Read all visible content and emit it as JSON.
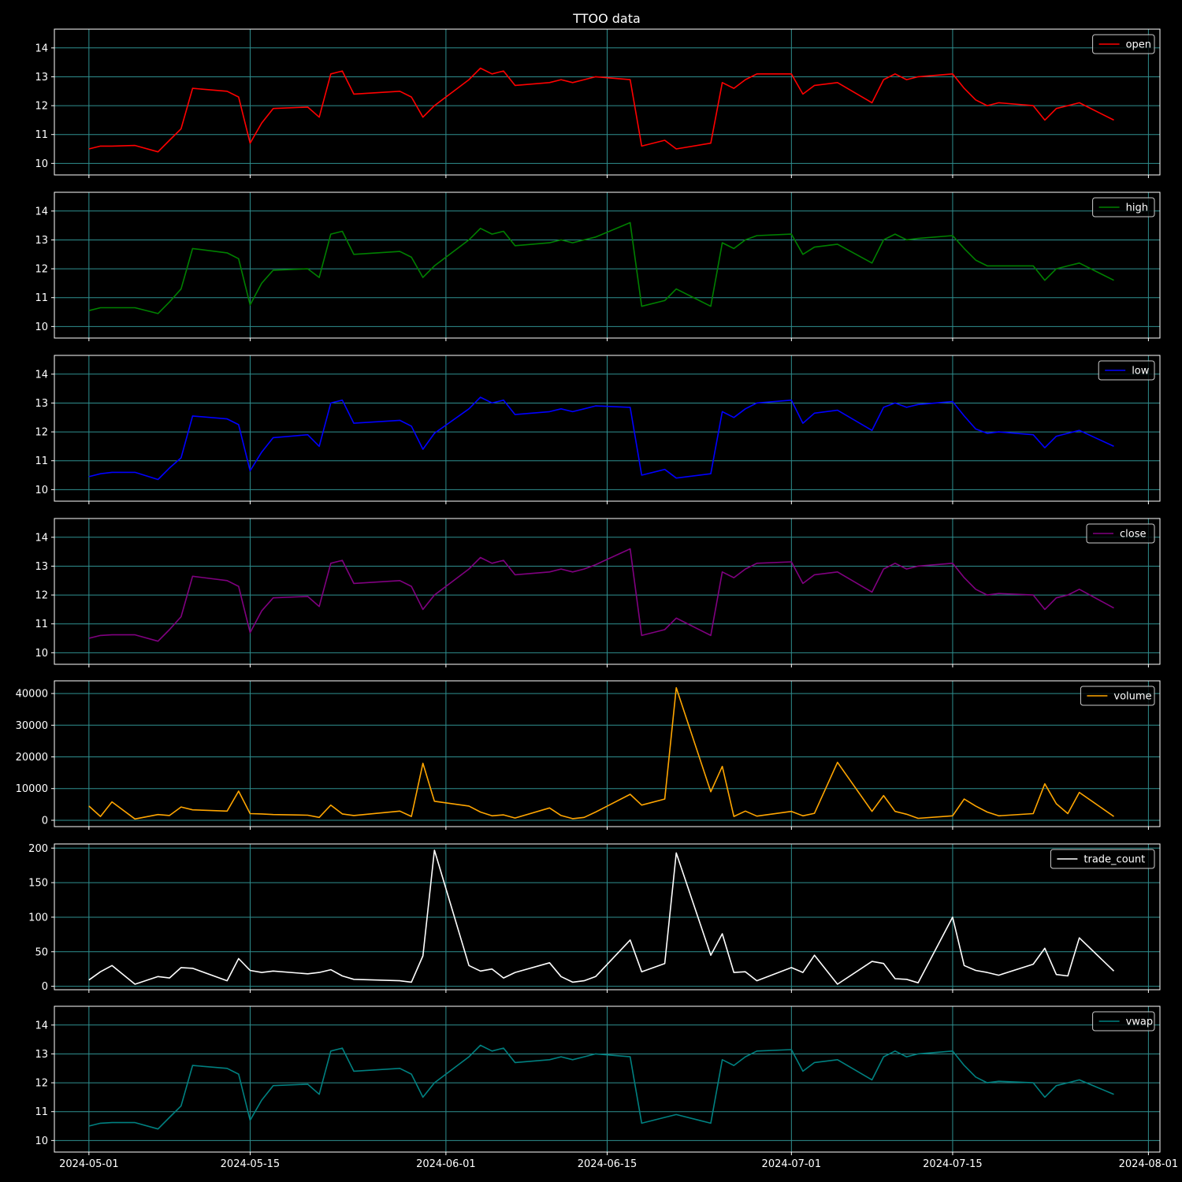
{
  "chart_data": {
    "type": "line",
    "title": "TTOO data",
    "background": "#000000",
    "grid_color": "#2f8f8f",
    "grid": true,
    "legend_position": "top-right",
    "x_axis": {
      "type": "date",
      "range": [
        "2024-04-28",
        "2024-08-02"
      ],
      "ticks": [
        "2024-05-01",
        "2024-05-15",
        "2024-06-01",
        "2024-06-15",
        "2024-07-01",
        "2024-07-15",
        "2024-08-01"
      ]
    },
    "price_axis": {
      "ylim": [
        9.6,
        14.65
      ],
      "ticks": [
        "10",
        "11",
        "12",
        "13",
        "14"
      ]
    },
    "volume_axis": {
      "ylim": [
        -2000,
        44000
      ],
      "ticks": [
        "0",
        "10000",
        "20000",
        "30000",
        "40000"
      ]
    },
    "trade_count_axis": {
      "ylim": [
        -5,
        206
      ],
      "ticks": [
        "0",
        "50",
        "100",
        "150",
        "200"
      ]
    },
    "series": [
      {
        "name": "open",
        "color": "#ff0000",
        "axis": "price_axis",
        "x": [
          "2024-05-01",
          "2024-05-02",
          "2024-05-03",
          "2024-05-05",
          "2024-05-07",
          "2024-05-08",
          "2024-05-09",
          "2024-05-10",
          "2024-05-13",
          "2024-05-14",
          "2024-05-15",
          "2024-05-16",
          "2024-05-17",
          "2024-05-20",
          "2024-05-21",
          "2024-05-22",
          "2024-05-23",
          "2024-05-24",
          "2024-05-28",
          "2024-05-29",
          "2024-05-30",
          "2024-05-31",
          "2024-06-03",
          "2024-06-04",
          "2024-06-05",
          "2024-06-06",
          "2024-06-07",
          "2024-06-10",
          "2024-06-11",
          "2024-06-12",
          "2024-06-13",
          "2024-06-14",
          "2024-06-17",
          "2024-06-18",
          "2024-06-20",
          "2024-06-21",
          "2024-06-24",
          "2024-06-25",
          "2024-06-26",
          "2024-06-27",
          "2024-06-28",
          "2024-07-01",
          "2024-07-02",
          "2024-07-03",
          "2024-07-05",
          "2024-07-08",
          "2024-07-09",
          "2024-07-10",
          "2024-07-11",
          "2024-07-12",
          "2024-07-15",
          "2024-07-16",
          "2024-07-17",
          "2024-07-18",
          "2024-07-19",
          "2024-07-22",
          "2024-07-23",
          "2024-07-24",
          "2024-07-25",
          "2024-07-26",
          "2024-07-29"
        ],
        "y": [
          10.5,
          10.6,
          10.6,
          10.62,
          10.4,
          10.8,
          11.2,
          12.6,
          12.5,
          12.3,
          10.7,
          11.4,
          11.9,
          11.95,
          11.6,
          13.1,
          13.2,
          12.4,
          12.5,
          12.3,
          11.6,
          12.0,
          12.9,
          13.3,
          13.1,
          13.2,
          12.7,
          12.8,
          12.9,
          12.8,
          12.9,
          13.0,
          12.9,
          10.6,
          10.8,
          10.5,
          10.7,
          12.8,
          12.6,
          12.9,
          13.1,
          13.1,
          12.4,
          12.7,
          12.8,
          12.1,
          12.9,
          13.1,
          12.9,
          13.0,
          13.1,
          12.6,
          12.2,
          12.0,
          12.1,
          12.0,
          11.5,
          11.9,
          12.0,
          12.1,
          11.5
        ]
      },
      {
        "name": "high",
        "color": "#008000",
        "axis": "price_axis",
        "x": [
          "2024-05-01",
          "2024-05-02",
          "2024-05-03",
          "2024-05-05",
          "2024-05-07",
          "2024-05-08",
          "2024-05-09",
          "2024-05-10",
          "2024-05-13",
          "2024-05-14",
          "2024-05-15",
          "2024-05-16",
          "2024-05-17",
          "2024-05-20",
          "2024-05-21",
          "2024-05-22",
          "2024-05-23",
          "2024-05-24",
          "2024-05-28",
          "2024-05-29",
          "2024-05-30",
          "2024-05-31",
          "2024-06-03",
          "2024-06-04",
          "2024-06-05",
          "2024-06-06",
          "2024-06-07",
          "2024-06-10",
          "2024-06-11",
          "2024-06-12",
          "2024-06-13",
          "2024-06-14",
          "2024-06-17",
          "2024-06-18",
          "2024-06-20",
          "2024-06-21",
          "2024-06-24",
          "2024-06-25",
          "2024-06-26",
          "2024-06-27",
          "2024-06-28",
          "2024-07-01",
          "2024-07-02",
          "2024-07-03",
          "2024-07-05",
          "2024-07-08",
          "2024-07-09",
          "2024-07-10",
          "2024-07-11",
          "2024-07-12",
          "2024-07-15",
          "2024-07-16",
          "2024-07-17",
          "2024-07-18",
          "2024-07-19",
          "2024-07-22",
          "2024-07-23",
          "2024-07-24",
          "2024-07-25",
          "2024-07-26",
          "2024-07-29"
        ],
        "y": [
          10.55,
          10.65,
          10.65,
          10.65,
          10.45,
          10.85,
          11.3,
          12.7,
          12.55,
          12.35,
          10.75,
          11.5,
          11.95,
          12.0,
          11.7,
          13.2,
          13.3,
          12.5,
          12.6,
          12.4,
          11.7,
          12.1,
          13.0,
          13.4,
          13.2,
          13.3,
          12.8,
          12.9,
          13.0,
          12.9,
          13.0,
          13.1,
          13.6,
          10.7,
          10.9,
          11.3,
          10.7,
          12.9,
          12.7,
          13.0,
          13.15,
          13.2,
          12.5,
          12.75,
          12.85,
          12.2,
          13.0,
          13.2,
          13.0,
          13.05,
          13.15,
          12.7,
          12.3,
          12.1,
          12.1,
          12.1,
          11.6,
          12.0,
          12.1,
          12.2,
          11.6
        ]
      },
      {
        "name": "low",
        "color": "#0000ff",
        "axis": "price_axis",
        "x": [
          "2024-05-01",
          "2024-05-02",
          "2024-05-03",
          "2024-05-05",
          "2024-05-07",
          "2024-05-08",
          "2024-05-09",
          "2024-05-10",
          "2024-05-13",
          "2024-05-14",
          "2024-05-15",
          "2024-05-16",
          "2024-05-17",
          "2024-05-20",
          "2024-05-21",
          "2024-05-22",
          "2024-05-23",
          "2024-05-24",
          "2024-05-28",
          "2024-05-29",
          "2024-05-30",
          "2024-05-31",
          "2024-06-03",
          "2024-06-04",
          "2024-06-05",
          "2024-06-06",
          "2024-06-07",
          "2024-06-10",
          "2024-06-11",
          "2024-06-12",
          "2024-06-13",
          "2024-06-14",
          "2024-06-17",
          "2024-06-18",
          "2024-06-20",
          "2024-06-21",
          "2024-06-24",
          "2024-06-25",
          "2024-06-26",
          "2024-06-27",
          "2024-06-28",
          "2024-07-01",
          "2024-07-02",
          "2024-07-03",
          "2024-07-05",
          "2024-07-08",
          "2024-07-09",
          "2024-07-10",
          "2024-07-11",
          "2024-07-12",
          "2024-07-15",
          "2024-07-16",
          "2024-07-17",
          "2024-07-18",
          "2024-07-19",
          "2024-07-22",
          "2024-07-23",
          "2024-07-24",
          "2024-07-25",
          "2024-07-26",
          "2024-07-29"
        ],
        "y": [
          10.45,
          10.55,
          10.6,
          10.6,
          10.35,
          10.75,
          11.1,
          12.55,
          12.45,
          12.25,
          10.65,
          11.3,
          11.8,
          11.9,
          11.5,
          13.0,
          13.1,
          12.3,
          12.4,
          12.2,
          11.4,
          11.95,
          12.8,
          13.2,
          13.0,
          13.1,
          12.6,
          12.7,
          12.8,
          12.7,
          12.8,
          12.9,
          12.85,
          10.5,
          10.7,
          10.4,
          10.55,
          12.7,
          12.5,
          12.8,
          13.0,
          13.1,
          12.3,
          12.65,
          12.75,
          12.05,
          12.85,
          13.0,
          12.85,
          12.95,
          13.05,
          12.55,
          12.1,
          11.95,
          12.0,
          11.9,
          11.45,
          11.85,
          11.95,
          12.05,
          11.5
        ]
      },
      {
        "name": "close",
        "color": "#800080",
        "axis": "price_axis",
        "x": [
          "2024-05-01",
          "2024-05-02",
          "2024-05-03",
          "2024-05-05",
          "2024-05-07",
          "2024-05-08",
          "2024-05-09",
          "2024-05-10",
          "2024-05-13",
          "2024-05-14",
          "2024-05-15",
          "2024-05-16",
          "2024-05-17",
          "2024-05-20",
          "2024-05-21",
          "2024-05-22",
          "2024-05-23",
          "2024-05-24",
          "2024-05-28",
          "2024-05-29",
          "2024-05-30",
          "2024-05-31",
          "2024-06-03",
          "2024-06-04",
          "2024-06-05",
          "2024-06-06",
          "2024-06-07",
          "2024-06-10",
          "2024-06-11",
          "2024-06-12",
          "2024-06-13",
          "2024-06-14",
          "2024-06-17",
          "2024-06-18",
          "2024-06-20",
          "2024-06-21",
          "2024-06-24",
          "2024-06-25",
          "2024-06-26",
          "2024-06-27",
          "2024-06-28",
          "2024-07-01",
          "2024-07-02",
          "2024-07-03",
          "2024-07-05",
          "2024-07-08",
          "2024-07-09",
          "2024-07-10",
          "2024-07-11",
          "2024-07-12",
          "2024-07-15",
          "2024-07-16",
          "2024-07-17",
          "2024-07-18",
          "2024-07-19",
          "2024-07-22",
          "2024-07-23",
          "2024-07-24",
          "2024-07-25",
          "2024-07-26",
          "2024-07-29"
        ],
        "y": [
          10.5,
          10.6,
          10.62,
          10.62,
          10.4,
          10.8,
          11.25,
          12.65,
          12.5,
          12.3,
          10.7,
          11.45,
          11.9,
          11.95,
          11.6,
          13.1,
          13.2,
          12.4,
          12.5,
          12.3,
          11.5,
          12.0,
          12.9,
          13.3,
          13.1,
          13.2,
          12.7,
          12.8,
          12.9,
          12.8,
          12.9,
          13.05,
          13.6,
          10.6,
          10.8,
          11.2,
          10.6,
          12.8,
          12.6,
          12.9,
          13.1,
          13.15,
          12.4,
          12.7,
          12.8,
          12.1,
          12.9,
          13.1,
          12.9,
          13.0,
          13.1,
          12.6,
          12.2,
          12.0,
          12.05,
          12.0,
          11.5,
          11.9,
          12.0,
          12.2,
          11.55
        ]
      },
      {
        "name": "volume",
        "color": "#ffa500",
        "axis": "volume_axis",
        "x": [
          "2024-05-01",
          "2024-05-02",
          "2024-05-03",
          "2024-05-05",
          "2024-05-07",
          "2024-05-08",
          "2024-05-09",
          "2024-05-10",
          "2024-05-13",
          "2024-05-14",
          "2024-05-15",
          "2024-05-16",
          "2024-05-17",
          "2024-05-20",
          "2024-05-21",
          "2024-05-22",
          "2024-05-23",
          "2024-05-24",
          "2024-05-28",
          "2024-05-29",
          "2024-05-30",
          "2024-05-31",
          "2024-06-03",
          "2024-06-04",
          "2024-06-05",
          "2024-06-06",
          "2024-06-07",
          "2024-06-10",
          "2024-06-11",
          "2024-06-12",
          "2024-06-13",
          "2024-06-14",
          "2024-06-17",
          "2024-06-18",
          "2024-06-20",
          "2024-06-21",
          "2024-06-24",
          "2024-06-25",
          "2024-06-26",
          "2024-06-27",
          "2024-06-28",
          "2024-07-01",
          "2024-07-02",
          "2024-07-03",
          "2024-07-05",
          "2024-07-08",
          "2024-07-09",
          "2024-07-10",
          "2024-07-11",
          "2024-07-12",
          "2024-07-15",
          "2024-07-16",
          "2024-07-17",
          "2024-07-18",
          "2024-07-19",
          "2024-07-22",
          "2024-07-23",
          "2024-07-24",
          "2024-07-25",
          "2024-07-26",
          "2024-07-29"
        ],
        "y": [
          4500,
          1200,
          5800,
          400,
          1800,
          1500,
          4200,
          3300,
          2900,
          9200,
          2100,
          2000,
          1800,
          1600,
          900,
          4800,
          2000,
          1500,
          2900,
          1200,
          18000,
          6000,
          4500,
          2600,
          1400,
          1700,
          700,
          3900,
          1500,
          500,
          900,
          2600,
          8200,
          4800,
          6700,
          41800,
          9000,
          17000,
          1200,
          2900,
          1300,
          2800,
          1400,
          2200,
          18300,
          2800,
          7800,
          2800,
          1900,
          600,
          1400,
          6700,
          4500,
          2600,
          1400,
          2100,
          11500,
          5200,
          2100,
          8800,
          1200
        ]
      },
      {
        "name": "trade_count",
        "color": "#ffffff",
        "axis": "trade_count_axis",
        "x": [
          "2024-05-01",
          "2024-05-02",
          "2024-05-03",
          "2024-05-05",
          "2024-05-07",
          "2024-05-08",
          "2024-05-09",
          "2024-05-10",
          "2024-05-13",
          "2024-05-14",
          "2024-05-15",
          "2024-05-16",
          "2024-05-17",
          "2024-05-20",
          "2024-05-21",
          "2024-05-22",
          "2024-05-23",
          "2024-05-24",
          "2024-05-28",
          "2024-05-29",
          "2024-05-30",
          "2024-05-31",
          "2024-06-03",
          "2024-06-04",
          "2024-06-05",
          "2024-06-06",
          "2024-06-07",
          "2024-06-10",
          "2024-06-11",
          "2024-06-12",
          "2024-06-13",
          "2024-06-14",
          "2024-06-17",
          "2024-06-18",
          "2024-06-20",
          "2024-06-21",
          "2024-06-24",
          "2024-06-25",
          "2024-06-26",
          "2024-06-27",
          "2024-06-28",
          "2024-07-01",
          "2024-07-02",
          "2024-07-03",
          "2024-07-05",
          "2024-07-08",
          "2024-07-09",
          "2024-07-10",
          "2024-07-11",
          "2024-07-12",
          "2024-07-15",
          "2024-07-16",
          "2024-07-17",
          "2024-07-18",
          "2024-07-19",
          "2024-07-22",
          "2024-07-23",
          "2024-07-24",
          "2024-07-25",
          "2024-07-26",
          "2024-07-29"
        ],
        "y": [
          9,
          21,
          30,
          3,
          14,
          12,
          27,
          26,
          8,
          40,
          23,
          20,
          22,
          18,
          20,
          24,
          15,
          10,
          8,
          6,
          44,
          197,
          30,
          22,
          25,
          12,
          20,
          34,
          14,
          6,
          8,
          14,
          67,
          21,
          33,
          193,
          45,
          76,
          20,
          21,
          8,
          27,
          20,
          45,
          3,
          36,
          33,
          11,
          10,
          5,
          100,
          30,
          23,
          20,
          16,
          32,
          55,
          17,
          15,
          70,
          22
        ]
      },
      {
        "name": "vwap",
        "color": "#008080",
        "axis": "price_axis",
        "x": [
          "2024-05-01",
          "2024-05-02",
          "2024-05-03",
          "2024-05-05",
          "2024-05-07",
          "2024-05-08",
          "2024-05-09",
          "2024-05-10",
          "2024-05-13",
          "2024-05-14",
          "2024-05-15",
          "2024-05-16",
          "2024-05-17",
          "2024-05-20",
          "2024-05-21",
          "2024-05-22",
          "2024-05-23",
          "2024-05-24",
          "2024-05-28",
          "2024-05-29",
          "2024-05-30",
          "2024-05-31",
          "2024-06-03",
          "2024-06-04",
          "2024-06-05",
          "2024-06-06",
          "2024-06-07",
          "2024-06-10",
          "2024-06-11",
          "2024-06-12",
          "2024-06-13",
          "2024-06-14",
          "2024-06-17",
          "2024-06-18",
          "2024-06-20",
          "2024-06-21",
          "2024-06-24",
          "2024-06-25",
          "2024-06-26",
          "2024-06-27",
          "2024-06-28",
          "2024-07-01",
          "2024-07-02",
          "2024-07-03",
          "2024-07-05",
          "2024-07-08",
          "2024-07-09",
          "2024-07-10",
          "2024-07-11",
          "2024-07-12",
          "2024-07-15",
          "2024-07-16",
          "2024-07-17",
          "2024-07-18",
          "2024-07-19",
          "2024-07-22",
          "2024-07-23",
          "2024-07-24",
          "2024-07-25",
          "2024-07-26",
          "2024-07-29"
        ],
        "y": [
          10.5,
          10.6,
          10.62,
          10.62,
          10.4,
          10.8,
          11.2,
          12.6,
          12.5,
          12.3,
          10.7,
          11.4,
          11.9,
          11.95,
          11.6,
          13.1,
          13.2,
          12.4,
          12.5,
          12.3,
          11.5,
          12.0,
          12.9,
          13.3,
          13.1,
          13.2,
          12.7,
          12.8,
          12.9,
          12.8,
          12.9,
          13.0,
          12.9,
          10.6,
          10.8,
          10.9,
          10.6,
          12.8,
          12.6,
          12.9,
          13.1,
          13.15,
          12.4,
          12.7,
          12.8,
          12.1,
          12.9,
          13.1,
          12.9,
          13.0,
          13.1,
          12.6,
          12.2,
          12.0,
          12.05,
          12.0,
          11.5,
          11.9,
          12.0,
          12.1,
          11.6
        ]
      }
    ]
  }
}
